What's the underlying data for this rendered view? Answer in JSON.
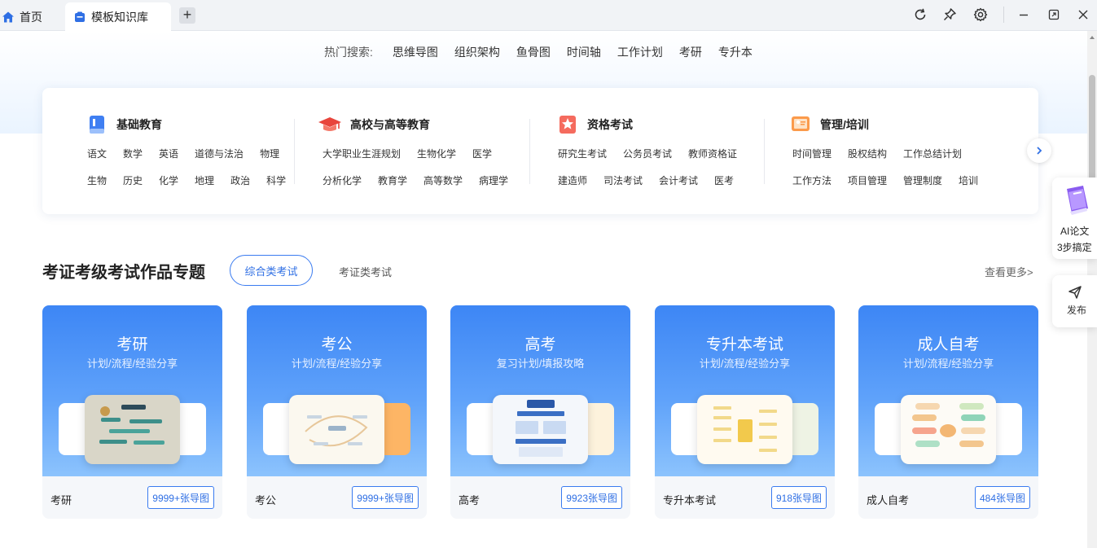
{
  "tabs": {
    "home_label": "首页",
    "active_label": "模板知识库",
    "add_label": "+"
  },
  "window_controls": [
    "refresh-icon",
    "pin-icon",
    "gear-icon",
    "minimize-icon",
    "restore-icon",
    "close-icon"
  ],
  "hot_search": {
    "label": "热门搜索:",
    "items": [
      "思维导图",
      "组织架构",
      "鱼骨图",
      "时间轴",
      "工作计划",
      "考研",
      "专升本"
    ]
  },
  "categories": [
    {
      "title": "基础教育",
      "icon": "book-icon",
      "row1": [
        "语文",
        "数学",
        "英语",
        "道德与法治",
        "物理"
      ],
      "row2": [
        "生物",
        "历史",
        "化学",
        "地理",
        "政治",
        "科学"
      ]
    },
    {
      "title": "高校与高等教育",
      "icon": "graduation-cap-icon",
      "row1": [
        "大学职业生涯规划",
        "生物化学",
        "医学"
      ],
      "row2": [
        "分析化学",
        "教育学",
        "高等数学",
        "病理学"
      ]
    },
    {
      "title": "资格考试",
      "icon": "award-icon",
      "row1": [
        "研究生考试",
        "公务员考试",
        "教师资格证"
      ],
      "row2": [
        "建造师",
        "司法考试",
        "会计考试",
        "医考"
      ]
    },
    {
      "title": "管理/培训",
      "icon": "presentation-icon",
      "row1": [
        "时间管理",
        "股权结构",
        "工作总结计划"
      ],
      "row2": [
        "工作方法",
        "项目管理",
        "管理制度",
        "培训"
      ]
    }
  ],
  "section": {
    "title": "考证考级考试作品专题",
    "tab_active": "综合类考试",
    "tab_inactive": "考证类考试",
    "more": "查看更多>"
  },
  "cards": [
    {
      "title": "考研",
      "subtitle": "计划/流程/经验分享",
      "name": "考研",
      "count": "9999+张导图"
    },
    {
      "title": "考公",
      "subtitle": "计划/流程/经验分享",
      "name": "考公",
      "count": "9999+张导图"
    },
    {
      "title": "高考",
      "subtitle": "复习计划/填报攻略",
      "name": "高考",
      "count": "9923张导图"
    },
    {
      "title": "专升本考试",
      "subtitle": "计划/流程/经验分享",
      "name": "专升本考试",
      "count": "918张导图"
    },
    {
      "title": "成人自考",
      "subtitle": "计划/流程/经验分享",
      "name": "成人自考",
      "count": "484张导图"
    }
  ],
  "ai_widget": {
    "line1": "AI论文",
    "line2": "3步搞定"
  },
  "publish_widget": {
    "label": "发布"
  },
  "colors": {
    "accent": "#2f6fe4",
    "card_gradient_top": "#3d86f5",
    "card_gradient_bottom": "#8cc3fd"
  }
}
